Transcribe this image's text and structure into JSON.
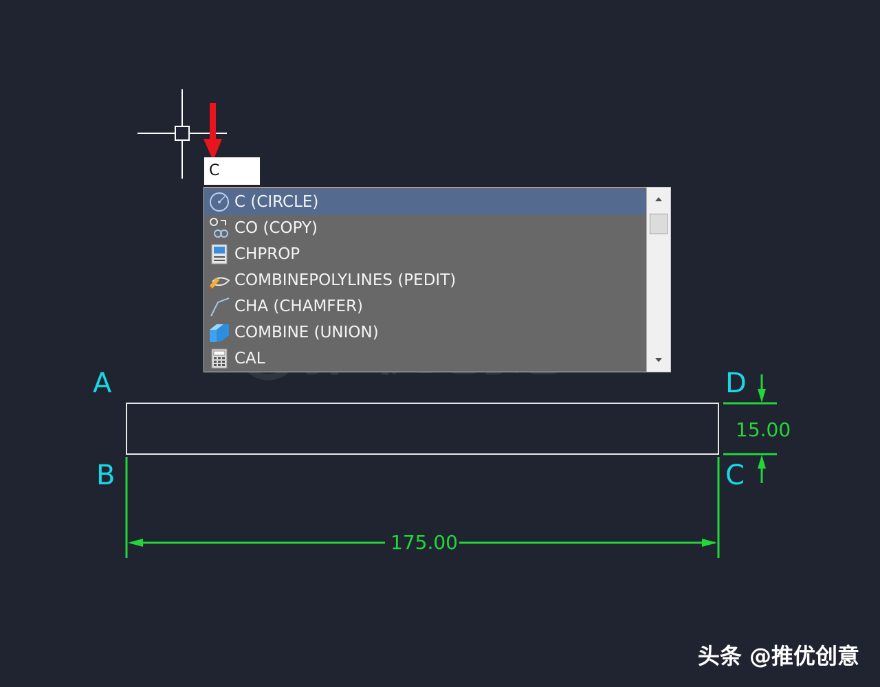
{
  "command_input": {
    "value": "C"
  },
  "autocomplete": {
    "items": [
      {
        "label": "C (CIRCLE)",
        "icon": "circle-icon",
        "selected": true
      },
      {
        "label": "CO (COPY)",
        "icon": "copy-icon",
        "selected": false
      },
      {
        "label": "CHPROP",
        "icon": "properties-icon",
        "selected": false
      },
      {
        "label": "COMBINEPOLYLINES (PEDIT)",
        "icon": "polyline-edit-icon",
        "selected": false
      },
      {
        "label": "CHA (CHAMFER)",
        "icon": "chamfer-icon",
        "selected": false
      },
      {
        "label": "COMBINE (UNION)",
        "icon": "union-icon",
        "selected": false
      },
      {
        "label": "CAL",
        "icon": "calculator-icon",
        "selected": false
      }
    ]
  },
  "drawing": {
    "points": {
      "a": "A",
      "b": "B",
      "c": "C",
      "d": "D"
    },
    "width_dimension": "175.00",
    "height_dimension": "15.00"
  },
  "watermark": "@推优创意",
  "footer_credit": "头条 @推优创意",
  "colors": {
    "background": "#1f2430",
    "point_label": "#19d7e6",
    "dimension": "#22d63a",
    "selection": "#546a8e",
    "arrow": "#e8141e"
  }
}
